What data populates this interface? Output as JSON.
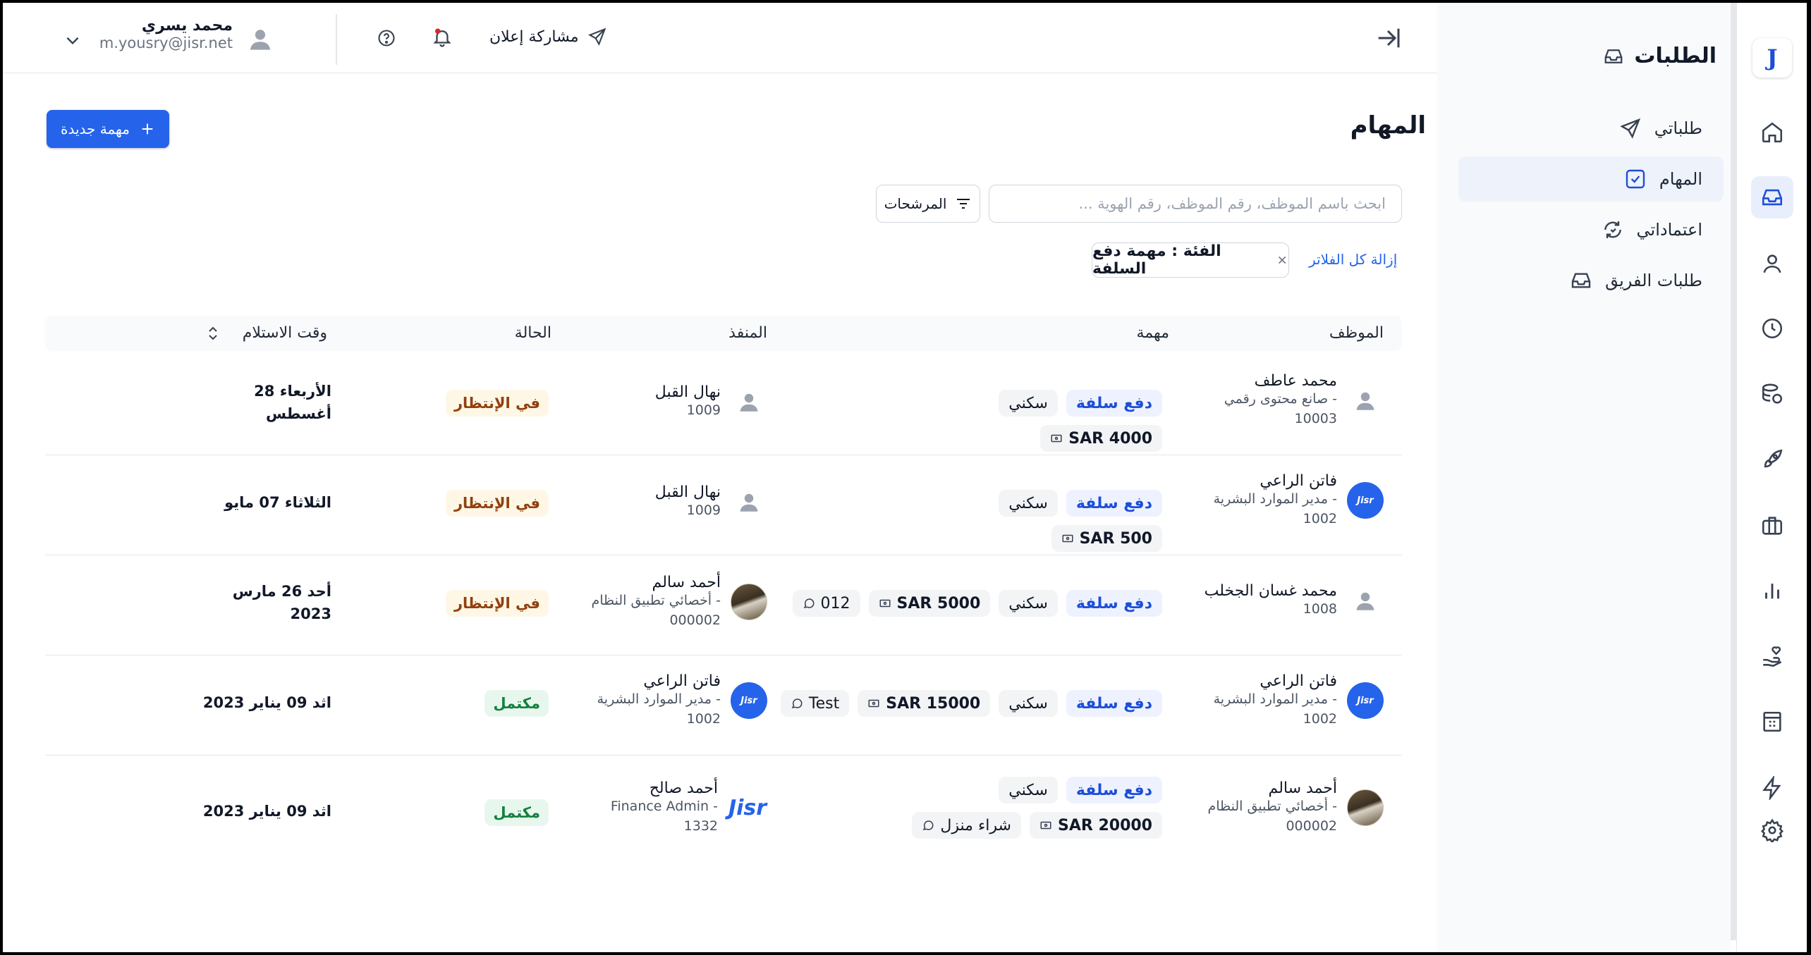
{
  "header": {
    "share_label": "مشاركة إعلان",
    "user_name": "محمد يسري",
    "user_email": "m.yousry@jisr.net"
  },
  "rail": {
    "logo": "J"
  },
  "sidebar": {
    "title": "الطلبات",
    "items": [
      {
        "label": "طلباتي",
        "icon": "send-icon"
      },
      {
        "label": "المهام",
        "icon": "checkbox-icon"
      },
      {
        "label": "اعتماداتي",
        "icon": "refresh-icon"
      },
      {
        "label": "طلبات الفريق",
        "icon": "inbox-icon"
      }
    ]
  },
  "main": {
    "title": "المهام",
    "new_task_label": "مهمة جديدة",
    "search_placeholder": "ابحث باسم الموظف، رقم الموظف، رقم الهوية ...",
    "filters_label": "المرشحات",
    "active_filter": "الفئة : مهمة دفع السلفة",
    "clear_filters": "إزالة كل الفلاتر"
  },
  "table": {
    "columns": [
      "الموظف",
      "مهمة",
      "المنفذ",
      "الحالة",
      "وقت الاستلام"
    ],
    "rows": [
      {
        "emp_name": "محمد عاطف",
        "emp_sub1": "صانع محتوى رقمي -",
        "emp_sub2": "10003",
        "tag_type": "دفع سلفة",
        "tag_cat": "سكني",
        "amount": "SAR 4000",
        "exec_name": "نهال القبل",
        "exec_sub1": "1009",
        "exec_sub2": "",
        "status": "في الإنتظار",
        "date1": "الأربعاء 28",
        "date2": "أغسطس"
      },
      {
        "emp_name": "فاتن الراعي",
        "emp_sub1": "مدير الموارد البشرية -",
        "emp_sub2": "1002",
        "tag_type": "دفع سلفة",
        "tag_cat": "سكني",
        "amount": "SAR 500",
        "exec_name": "نهال القبل",
        "exec_sub1": "1009",
        "exec_sub2": "",
        "status": "في الإنتظار",
        "date1": "الثلاثاء 07 مايو",
        "date2": ""
      },
      {
        "emp_name": "محمد غسان الجخلب",
        "emp_sub1": "1008",
        "emp_sub2": "",
        "tag_type": "دفع سلفة",
        "tag_cat": "سكني",
        "amount": "SAR 5000",
        "note": "012",
        "exec_name": "أحمد سالم",
        "exec_sub1": "أخصائي تطبيق النظام -",
        "exec_sub2": "000002",
        "status": "في الإنتظار",
        "date1": "أحد 26 مارس",
        "date2": "2023"
      },
      {
        "emp_name": "فاتن الراعي",
        "emp_sub1": "مدير الموارد البشرية -",
        "emp_sub2": "1002",
        "tag_type": "دفع سلفة",
        "tag_cat": "سكني",
        "amount": "SAR 15000",
        "note": "Test",
        "exec_name": "فاتن الراعي",
        "exec_sub1": "مدير الموارد البشرية -",
        "exec_sub2": "1002",
        "status": "مكتمل",
        "date1": "اثد 09 يناير 2023",
        "date2": ""
      },
      {
        "emp_name": "أحمد سالم",
        "emp_sub1": "أخصائي تطبيق النظام -",
        "emp_sub2": "000002",
        "tag_type": "دفع سلفة",
        "tag_cat": "سكني",
        "amount": "SAR 20000",
        "note": "شراء منزل",
        "exec_name": "أحمد صالح",
        "exec_sub1": "Finance Admin -",
        "exec_sub2": "1332",
        "status": "مكتمل",
        "date1": "اثد 09 يناير 2023",
        "date2": ""
      }
    ]
  },
  "avatars": {
    "jisr_small": "Jisr",
    "jisr_logo": "Jisr"
  },
  "colors": {
    "primary": "#2563eb",
    "pending_bg": "#fef7e6",
    "done_bg": "#e8f7ee"
  }
}
